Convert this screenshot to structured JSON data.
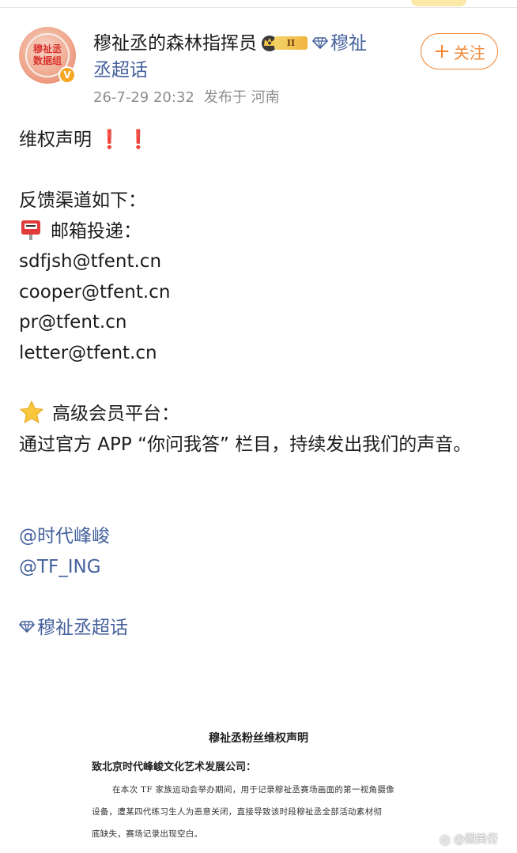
{
  "post": {
    "author_name": "穆祉丞的森林指挥员",
    "rank_label": "II",
    "topic_part1": "穆祉",
    "topic_part2": "丞超话",
    "avatar_text_line1": "穆祉丞",
    "avatar_text_line2": "数据组",
    "timestamp": "26-7-29 20:32",
    "location": "发布于 河南",
    "follow_label": "关注",
    "follow_plus": "+"
  },
  "content": {
    "title": "维权声明",
    "exclaim1": "❗",
    "exclaim2": "❗",
    "channels_heading": "反馈渠道如下：",
    "mail_heading": "邮箱投递：",
    "emails": [
      "sdfjsh@tfent.cn",
      "cooper@tfent.cn",
      "pr@tfent.cn",
      "letter@tfent.cn"
    ],
    "vip_heading": "高级会员平台：",
    "vip_text": "通过官方 APP “你问我答” 栏目，持续发出我们的声音。",
    "mention1": "@时代峰峻",
    "mention2": "@TF_ING",
    "topic_tag": "穆祉丞超话"
  },
  "document": {
    "title": "穆祉丞粉丝维权声明",
    "addressee": "致北京时代峰峻文化艺术发展公司：",
    "para_line1": "在本次 TF 家族运动会举办期间，用于记录穆祉丞赛场画面的第一视角摄像",
    "para_line2": "设备，遭某四代练习生人为恶意关闭，直接导致该时段穆祉丞全部活动素材彻",
    "para_line3": "底缺失，赛场记录出现空白。"
  },
  "watermark": {
    "text": "@图美伢"
  },
  "colors": {
    "link_blue": "#44619c",
    "follow_orange": "#f08a3b",
    "exclaim_red": "#e6221c",
    "meta_gray": "#8d8d8d"
  }
}
